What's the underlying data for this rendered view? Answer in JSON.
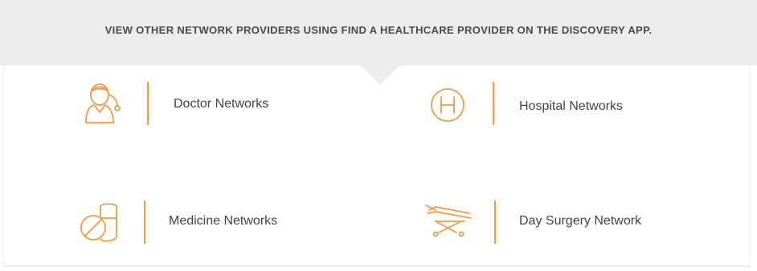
{
  "banner": {
    "text": "VIEW OTHER NETWORK PROVIDERS USING FIND A HEALTHCARE PROVIDER ON THE DISCOVERY APP."
  },
  "colors": {
    "accent": "#f39a43",
    "banner_bg": "#ececec",
    "text": "#444444"
  },
  "networks": [
    {
      "label": "Doctor Networks",
      "icon": "doctor-icon"
    },
    {
      "label": "Hospital Networks",
      "icon": "hospital-icon"
    },
    {
      "label": "Medicine Networks",
      "icon": "medicine-pill-icon"
    },
    {
      "label": "Day Surgery Network",
      "icon": "stretcher-icon"
    }
  ]
}
